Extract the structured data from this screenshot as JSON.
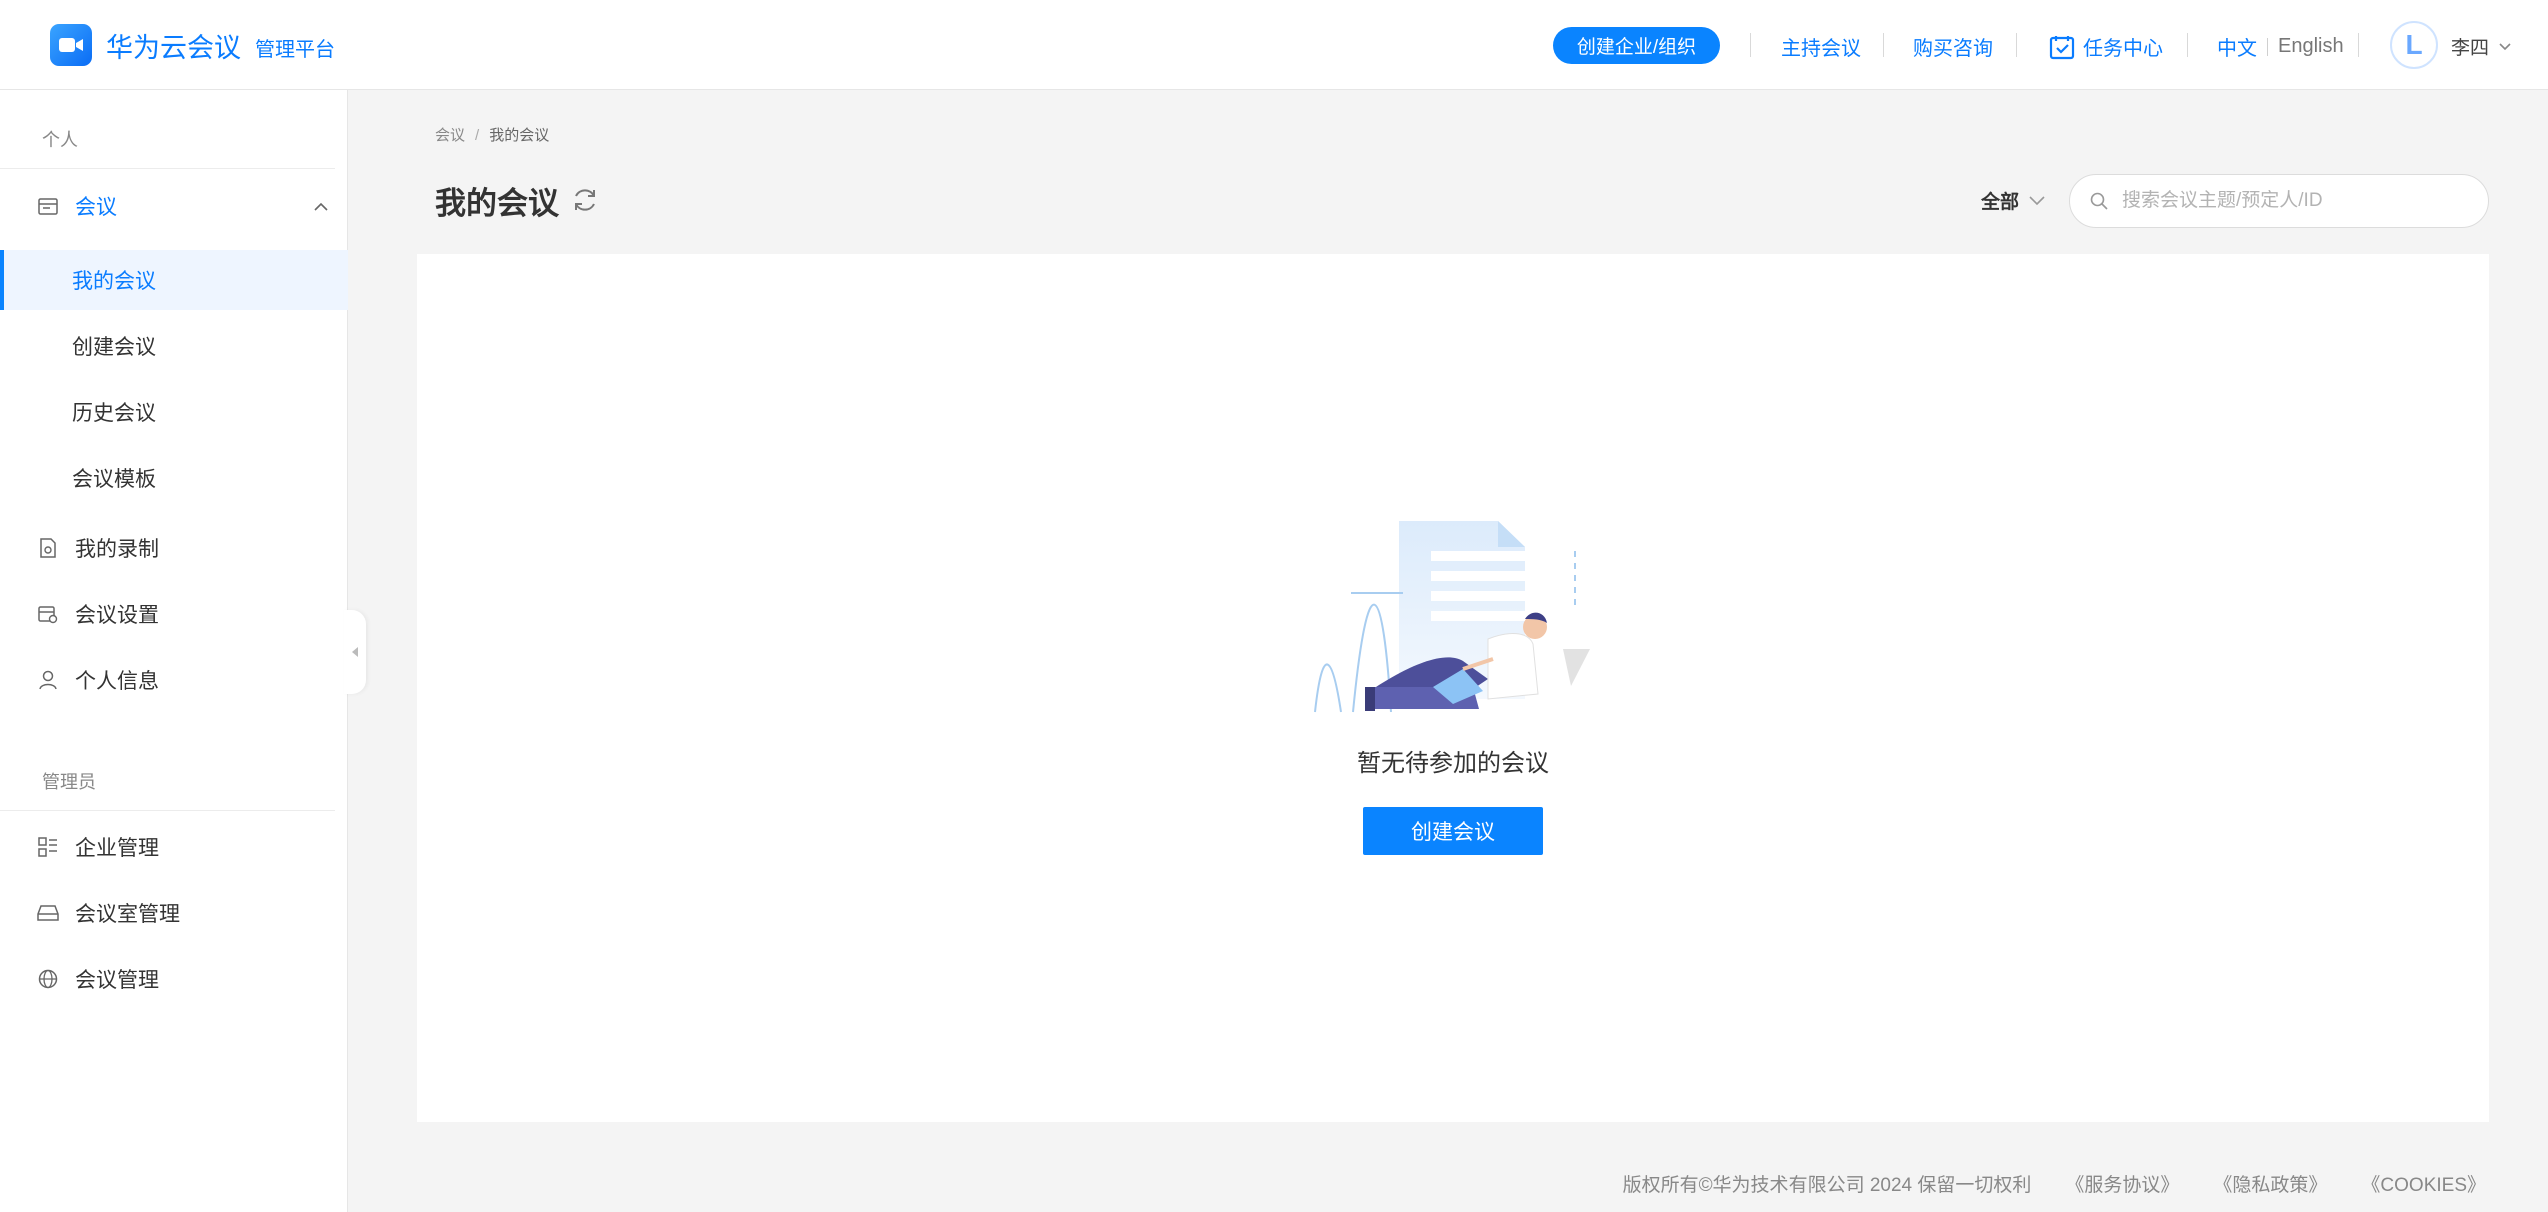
{
  "header": {
    "app_name": "华为云会议",
    "app_sub": "管理平台",
    "create_org": "创建企业/组织",
    "host_meeting": "主持会议",
    "purchase": "购买咨询",
    "task_center": "任务中心",
    "lang_zh": "中文",
    "lang_en": "English",
    "avatar_letter": "L",
    "username": "李四",
    "accent": "#0a84ff"
  },
  "sidebar": {
    "section_personal": "个人",
    "meeting_group": "会议",
    "sub_items": [
      "我的会议",
      "创建会议",
      "历史会议",
      "会议模板"
    ],
    "items_personal": [
      "我的录制",
      "会议设置",
      "个人信息"
    ],
    "section_admin": "管理员",
    "items_admin": [
      "企业管理",
      "会议室管理",
      "会议管理"
    ]
  },
  "main": {
    "breadcrumb": [
      "会议",
      "我的会议"
    ],
    "title": "我的会议",
    "filter_label": "全部",
    "search_placeholder": "搜索会议主题/预定人/ID",
    "empty_text": "暂无待参加的会议",
    "create_button": "创建会议"
  },
  "footer": {
    "copyright": "版权所有©华为技术有限公司 2024 保留一切权利",
    "service": "《服务协议》",
    "privacy": "《隐私政策》",
    "cookies": "《COOKIES》"
  }
}
